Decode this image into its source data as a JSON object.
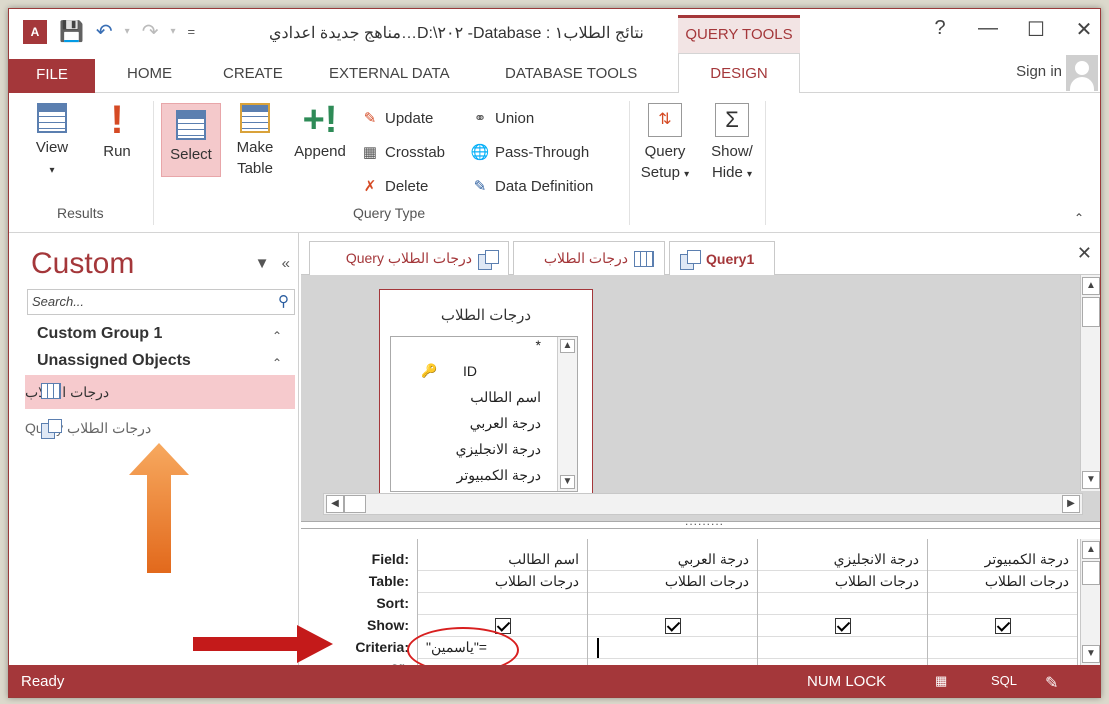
{
  "window": {
    "app_icon_text": "A",
    "title": "مناهج جديدة اعدادي…D:\\٢٠٢ -Database : نتائج الطلاب١",
    "context_tab": "QUERY TOOLS",
    "help": "?",
    "minimize": "—",
    "maximize": "☐",
    "close": "✕",
    "qat_dropdown": "="
  },
  "tabs": {
    "file": "FILE",
    "home": "HOME",
    "create": "CREATE",
    "external_data": "EXTERNAL DATA",
    "database_tools": "DATABASE TOOLS",
    "design": "DESIGN",
    "sign_in": "Sign in"
  },
  "ribbon": {
    "results": {
      "view": "View",
      "run": "Run",
      "label": "Results"
    },
    "query_type": {
      "select": "Select",
      "make_table_1": "Make",
      "make_table_2": "Table",
      "append": "Append",
      "update": "Update",
      "crosstab": "Crosstab",
      "delete": "Delete",
      "union": "Union",
      "pass_through": "Pass-Through",
      "data_definition": "Data Definition",
      "label": "Query Type"
    },
    "query_setup_1": "Query",
    "query_setup_2": "Setup",
    "show_hide_1": "Show/",
    "show_hide_2": "Hide",
    "sigma": "Σ"
  },
  "nav": {
    "title": "Custom",
    "search_placeholder": "Search...",
    "groups": [
      {
        "label": "Custom Group 1"
      },
      {
        "label": "Unassigned Objects"
      }
    ],
    "items": [
      {
        "label": "درجات الطلاب",
        "type": "table"
      },
      {
        "label": "درجات الطلاب Query",
        "type": "query"
      }
    ]
  },
  "doc_tabs": [
    {
      "label": "درجات الطلاب Query"
    },
    {
      "label": "درجات الطلاب"
    },
    {
      "label": "Query1"
    }
  ],
  "table_box": {
    "title": "درجات الطلاب",
    "fields": [
      "*",
      "ID",
      "اسم الطالب",
      "درجة العربي",
      "درجة الانجليزي",
      "درجة الكمبيوتر"
    ]
  },
  "qbe": {
    "row_labels": [
      "Field:",
      "Table:",
      "Sort:",
      "Show:",
      "Criteria:",
      "or:"
    ],
    "columns": [
      {
        "field": "اسم الطالب",
        "table": "درجات الطلاب",
        "show": true,
        "criteria": "=\"ياسمين\""
      },
      {
        "field": "درجة العربي",
        "table": "درجات الطلاب",
        "show": true,
        "criteria": ""
      },
      {
        "field": "درجة الانجليزي",
        "table": "درجات الطلاب",
        "show": true,
        "criteria": ""
      },
      {
        "field": "درجة الكمبيوتر",
        "table": "درجات الطلاب",
        "show": true,
        "criteria": ""
      }
    ]
  },
  "status": {
    "ready": "Ready",
    "num_lock": "NUM LOCK",
    "sql": "SQL"
  },
  "colors": {
    "accent": "#a4373a",
    "highlight": "#f4c9cb",
    "annotation_red": "#d81f1f",
    "annotation_orange": "#ee7a2a"
  }
}
